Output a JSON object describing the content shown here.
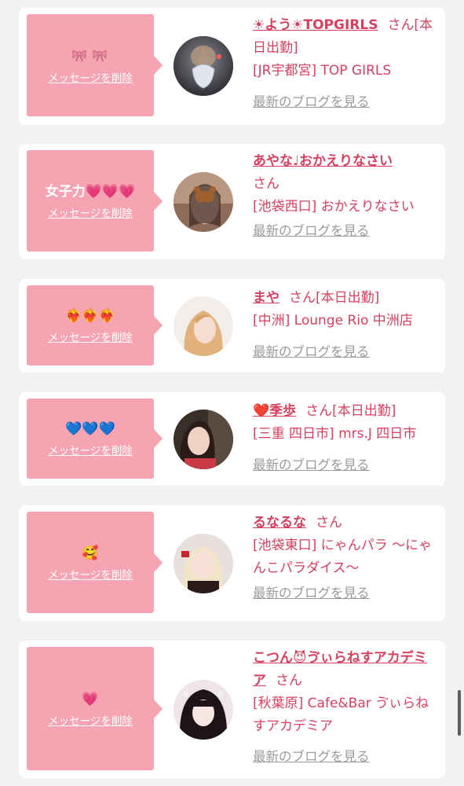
{
  "cards": [
    {
      "message": "",
      "message_emoji": "ribbons",
      "delete_label": "メッセージを削除",
      "name": "☀よう☀TOPGIRLS",
      "honorific": "さん[本日出勤]",
      "shop": "[JR宇都宮] TOP GIRLS",
      "blog_label": "最新のブログを見る"
    },
    {
      "message": "女子力💗💗💗",
      "delete_label": "メッセージを削除",
      "name": "あやな♩おかえりなさい",
      "honorific": "さん",
      "shop": "[池袋西口] おかえりなさい",
      "blog_label": "最新のブログを見る"
    },
    {
      "message": "❤️‍🔥❤️‍🔥❤️‍🔥",
      "delete_label": "メッセージを削除",
      "name": "まや",
      "honorific": "さん[本日出勤]",
      "shop": "[中洲] Lounge Rio 中洲店",
      "blog_label": "最新のブログを見る"
    },
    {
      "message": "💙💙💙",
      "delete_label": "メッセージを削除",
      "name": "❤️季歩",
      "honorific": "さん[本日出勤]",
      "shop": "[三重 四日市] mrs.J 四日市",
      "blog_label": "最新のブログを見る"
    },
    {
      "message": "🥰",
      "delete_label": "メッセージを削除",
      "name": "るなるな",
      "honorific": "さん",
      "shop": "[池袋東口] にゃんパラ 〜にゃんこパラダイス〜",
      "blog_label": "最新のブログを見る"
    },
    {
      "message": "💗",
      "delete_label": "メッセージを削除",
      "name": "こつん😈ゔぃらねすアカデミア",
      "honorific": "さん",
      "shop": "[秋葉原] Cafe&Bar ゔぃらねすアカデミア",
      "blog_label": "最新のブログを見る"
    }
  ],
  "colors": {
    "bubble": "#f7a4b2",
    "accent": "#d6405f",
    "muted": "#9a9a9a",
    "background": "#f2f2f4"
  }
}
